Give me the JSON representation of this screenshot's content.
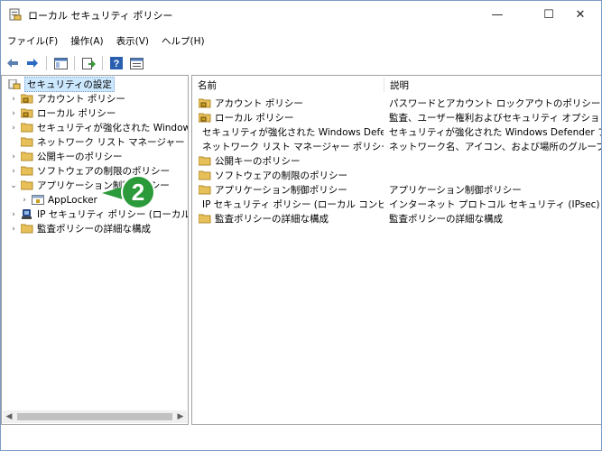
{
  "window": {
    "title": "ローカル セキュリティ ポリシー",
    "minimize_glyph": "—",
    "maximize_glyph": "☐",
    "close_glyph": "✕"
  },
  "menubar": [
    "ファイル(F)",
    "操作(A)",
    "表示(V)",
    "ヘルプ(H)"
  ],
  "toolbar": [
    "back-icon",
    "forward-icon",
    "show-hide-tree-icon",
    "export-list-icon",
    "help-icon",
    "properties-icon"
  ],
  "tree": [
    {
      "label": "セキュリティの設定",
      "chevron": "",
      "icon": "security-settings-icon",
      "selected": true
    },
    {
      "label": "アカウント ポリシー",
      "chevron": "›",
      "icon": "folder-lock-icon"
    },
    {
      "label": "ローカル ポリシー",
      "chevron": "›",
      "icon": "folder-lock-icon"
    },
    {
      "label": "セキュリティが強化された Windows Defender",
      "chevron": "›",
      "icon": "folder-icon"
    },
    {
      "label": "ネットワーク リスト マネージャー ポリシー",
      "chevron": "",
      "icon": "folder-icon"
    },
    {
      "label": "公開キーのポリシー",
      "chevron": "›",
      "icon": "folder-icon"
    },
    {
      "label": "ソフトウェアの制限のポリシー",
      "chevron": "›",
      "icon": "folder-icon"
    },
    {
      "label": "アプリケーション制御ポリシー",
      "chevron": "⌄",
      "icon": "folder-icon"
    },
    {
      "label": "AppLocker",
      "chevron": "›",
      "icon": "applocker-icon",
      "child": true
    },
    {
      "label": "IP セキュリティ ポリシー (ローカル コンピューター)",
      "chevron": "›",
      "icon": "ip-security-icon"
    },
    {
      "label": "監査ポリシーの詳細な構成",
      "chevron": "›",
      "icon": "folder-icon"
    }
  ],
  "list": {
    "columns": [
      "名前",
      "説明"
    ],
    "rows": [
      {
        "name": "アカウント ポリシー",
        "desc": "パスワードとアカウント ロックアウトのポリシー",
        "icon": "folder-lock-icon"
      },
      {
        "name": "ローカル ポリシー",
        "desc": "監査、ユーザー権利およびセキュリティ オプションのポリ...",
        "icon": "folder-lock-icon"
      },
      {
        "name": "セキュリティが強化された Windows Defender...",
        "desc": "セキュリティが強化された Windows Defender ファイ...",
        "icon": "folder-icon"
      },
      {
        "name": "ネットワーク リスト マネージャー ポリシー",
        "desc": "ネットワーク名、アイコン、および場所のグループ ポリシ...",
        "icon": "folder-icon"
      },
      {
        "name": "公開キーのポリシー",
        "desc": "",
        "icon": "folder-icon"
      },
      {
        "name": "ソフトウェアの制限のポリシー",
        "desc": "",
        "icon": "folder-icon"
      },
      {
        "name": "アプリケーション制御ポリシー",
        "desc": "アプリケーション制御ポリシー",
        "icon": "folder-icon"
      },
      {
        "name": "IP セキュリティ ポリシー (ローカル コンピューター)",
        "desc": "インターネット プロトコル セキュリティ (IPsec) 管理。ほ...",
        "icon": "ip-security-icon"
      },
      {
        "name": "監査ポリシーの詳細な構成",
        "desc": "監査ポリシーの詳細な構成",
        "icon": "folder-icon"
      }
    ]
  },
  "callout": {
    "number": "2",
    "color": "#2b9a3a"
  },
  "colors": {
    "selection": "#cce8ff",
    "folder": "#e8c05a",
    "border": "#a0a0a0"
  }
}
